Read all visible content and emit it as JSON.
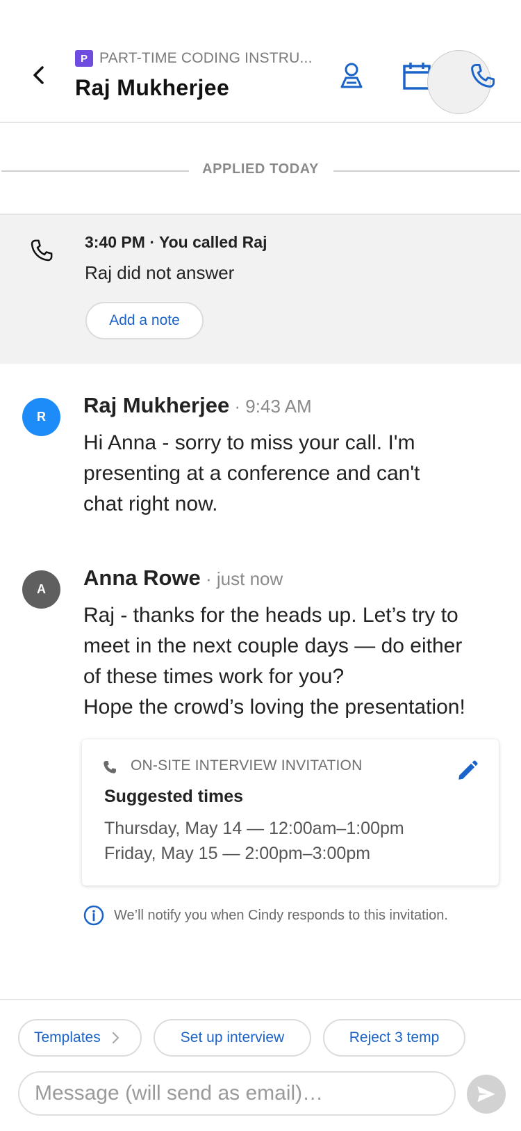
{
  "header": {
    "job_badge": "P",
    "job_title": "PART-TIME CODING INSTRU...",
    "candidate_name": "Raj Mukherjee",
    "accent_color": "#1a63c9",
    "badge_color": "#6e4ce0",
    "icons": [
      "back-chevron-icon",
      "candidate-profile-icon",
      "calendar-icon",
      "phone-icon"
    ]
  },
  "divider": {
    "label": "APPLIED TODAY"
  },
  "call_event": {
    "meta": "3:40 PM · You called Raj",
    "text": "Raj did not answer",
    "add_note_label": "Add a note"
  },
  "messages": [
    {
      "avatar_initial": "R",
      "avatar_color": "#1d8cf8",
      "sender": "Raj Mukherjee",
      "time": " · 9:43 AM",
      "lines": [
        "Hi Anna - sorry to miss your call. I'm",
        "presenting at a conference and can't",
        "chat right now."
      ]
    },
    {
      "avatar_initial": "A",
      "avatar_color": "#5f5f5f",
      "sender": "Anna Rowe",
      "time": " · just now",
      "lines": [
        "Raj - thanks for the heads up. Let’s try to",
        "meet in the next couple days — do either",
        "of these times work for you?",
        "Hope the crowd’s loving the presentation!"
      ]
    }
  ],
  "invitation": {
    "type_label": "ON-SITE INTERVIEW INVITATION",
    "title": "Suggested times",
    "slots": [
      "Thursday, May 14 — 12:00am–1:00pm",
      "Friday, May 15 — 2:00pm–3:00pm"
    ]
  },
  "notify_text": "We’ll notify you when Cindy responds to this invitation.",
  "bottom_bar": {
    "chips": [
      "Templates",
      "Set up interview",
      "Reject 3 temp"
    ],
    "message_placeholder": "Message (will send as email)…"
  }
}
